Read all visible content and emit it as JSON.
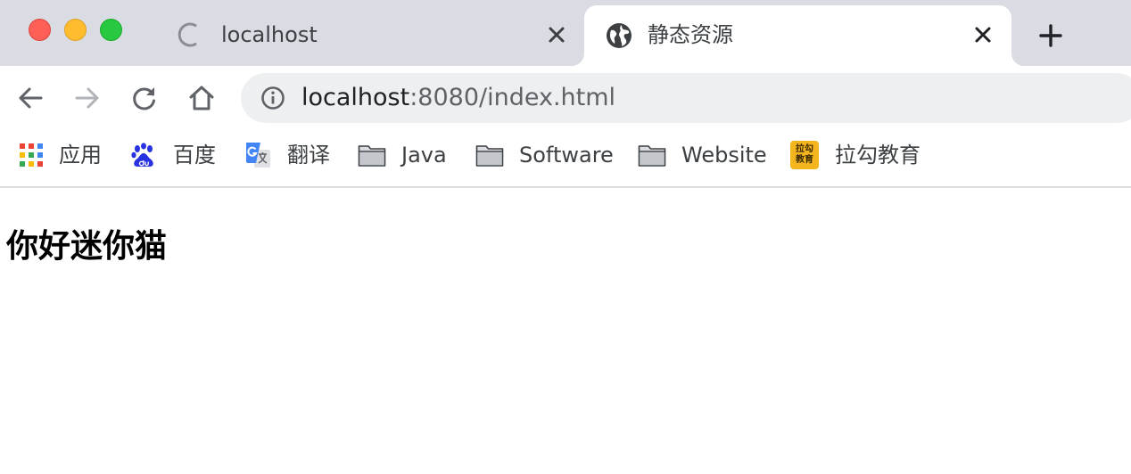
{
  "window": {
    "controls": {
      "close_color": "#fe5f57",
      "minimize_color": "#febc2e",
      "maximize_color": "#28c840"
    }
  },
  "tabs": [
    {
      "title": "localhost",
      "icon": "loading-spinner-icon",
      "active": false
    },
    {
      "title": "静态资源",
      "icon": "globe-icon",
      "active": true
    }
  ],
  "toolbar": {
    "back_icon": "arrow-left-icon",
    "forward_icon": "arrow-right-icon",
    "reload_icon": "reload-icon",
    "home_icon": "home-icon"
  },
  "address_bar": {
    "info_icon": "info-icon",
    "url_host": "localhost",
    "url_rest": ":8080/index.html"
  },
  "bookmarks": [
    {
      "label": "应用",
      "icon": "apps-grid-icon"
    },
    {
      "label": "百度",
      "icon": "baidu-paw-icon"
    },
    {
      "label": "翻译",
      "icon": "google-translate-icon"
    },
    {
      "label": "Java",
      "icon": "folder-icon"
    },
    {
      "label": "Software",
      "icon": "folder-icon"
    },
    {
      "label": "Website",
      "icon": "folder-icon"
    },
    {
      "label": "拉勾教育",
      "icon": "lagou-icon",
      "icon_text": "拉勾教育"
    }
  ],
  "page": {
    "heading": "你好迷你猫"
  }
}
